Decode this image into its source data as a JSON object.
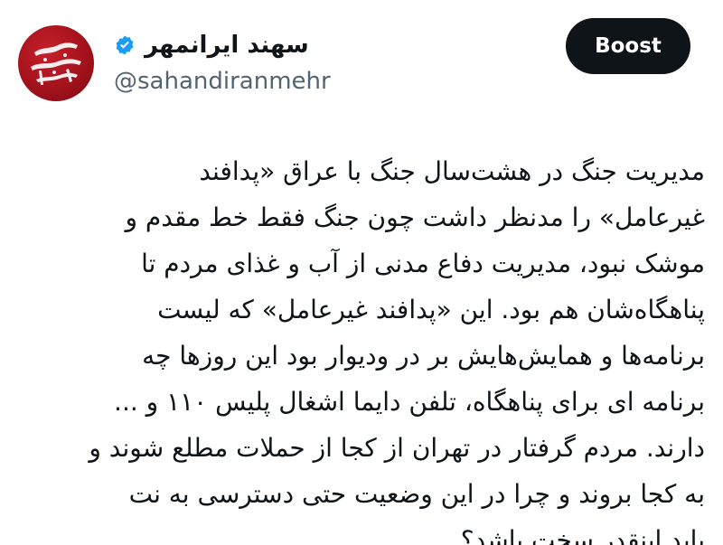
{
  "profile": {
    "display_name": "سهند ایرانمهر",
    "handle": "@sahandiranmehr",
    "verified": true,
    "avatar_text": "سهند ایرانمهر"
  },
  "actions": {
    "boost_label": "Boost"
  },
  "tweet": {
    "lines": [
      "مدیریت جنگ در هشت‌سال جنگ با عراق «پدافند",
      "غیرعامل» را مدنظر داشت چون جنگ فقط خط مقدم و",
      "موشک نبود، مدیریت دفاع مدنی از آب و غذای مردم تا",
      "پناهگاه‌شان هم بود. این «پدافند غیرعامل» که لیست",
      "برنامه‌ها و همایش‌هایش بر در ودیوار بود این روزها چه",
      "برنامه ای برای پناهگاه، تلفن دایما اشغال پلیس ۱۱۰ و ...",
      "دارند. مردم گرفتار در تهران از کجا از حملات مطلع شوند و",
      "به کجا بروند و چرا در این وضعیت حتی دسترسی به نت",
      "باید اینقدر سخت باشد؟"
    ]
  },
  "colors": {
    "text": "#0f1419",
    "secondary": "#536471",
    "verified": "#1d9bf0",
    "button_bg": "#0f1419",
    "avatar_red": "#a3121c"
  },
  "icons": {
    "verified": "verified-badge-icon"
  }
}
